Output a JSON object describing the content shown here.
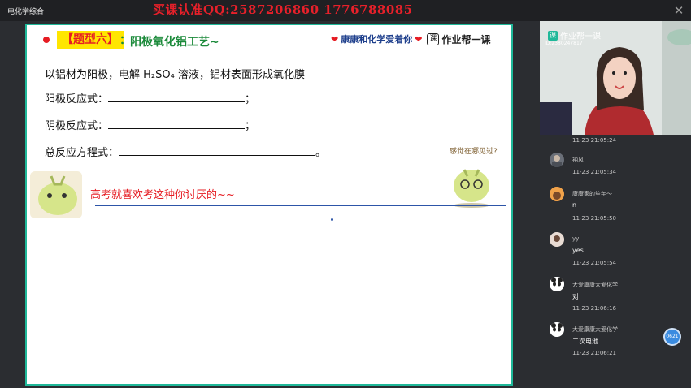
{
  "app": {
    "title": "电化学综合"
  },
  "watermark": "买课认准QQ:2587206860   1776788085",
  "slide": {
    "type_tag": "【题型六】",
    "type_colon": "：",
    "type_title": "阳极氧化铝工艺~",
    "brand_text": "康康和化学爱着你",
    "logo_glyph": "课",
    "logo_text": "作业帮一课",
    "intro": "以铝材为阳极，电解 H₂SO₄ 溶液，铝材表面形成氧化膜",
    "anode_label": "阳极反应式：",
    "anode_end": "；",
    "cathode_label": "阴极反应式：",
    "cathode_end": "；",
    "total_label": "总反应方程式：",
    "total_end": "。",
    "hint_bubble": "感觉在哪见过?",
    "hate_text": "高考就喜欢考这种你讨厌的~~"
  },
  "video": {
    "badge_logo": "课",
    "badge_text": "作业帮一课",
    "id_text": "ID:2380247817"
  },
  "chat": [
    {
      "name": "",
      "text": "",
      "time": "11-23 21:05:24"
    },
    {
      "name": "袖风",
      "text": "",
      "time": "11-23 21:05:34"
    },
    {
      "name": "康康家的笙年～",
      "text": "n",
      "time": "11-23 21:05:50"
    },
    {
      "name": "yy",
      "text": "yes",
      "time": "11-23 21:05:54"
    },
    {
      "name": "大爱康康大爱化学",
      "text": "对",
      "time": "11-23 21:06:16"
    },
    {
      "name": "大爱康康大爱化学",
      "text": "二次电池",
      "time": "11-23 21:06:21"
    }
  ],
  "float_btn": "0621",
  "colors": {
    "accent": "#1fb899",
    "red": "#e61c23",
    "green": "#1b8a3a",
    "blue": "#2d55a8"
  }
}
